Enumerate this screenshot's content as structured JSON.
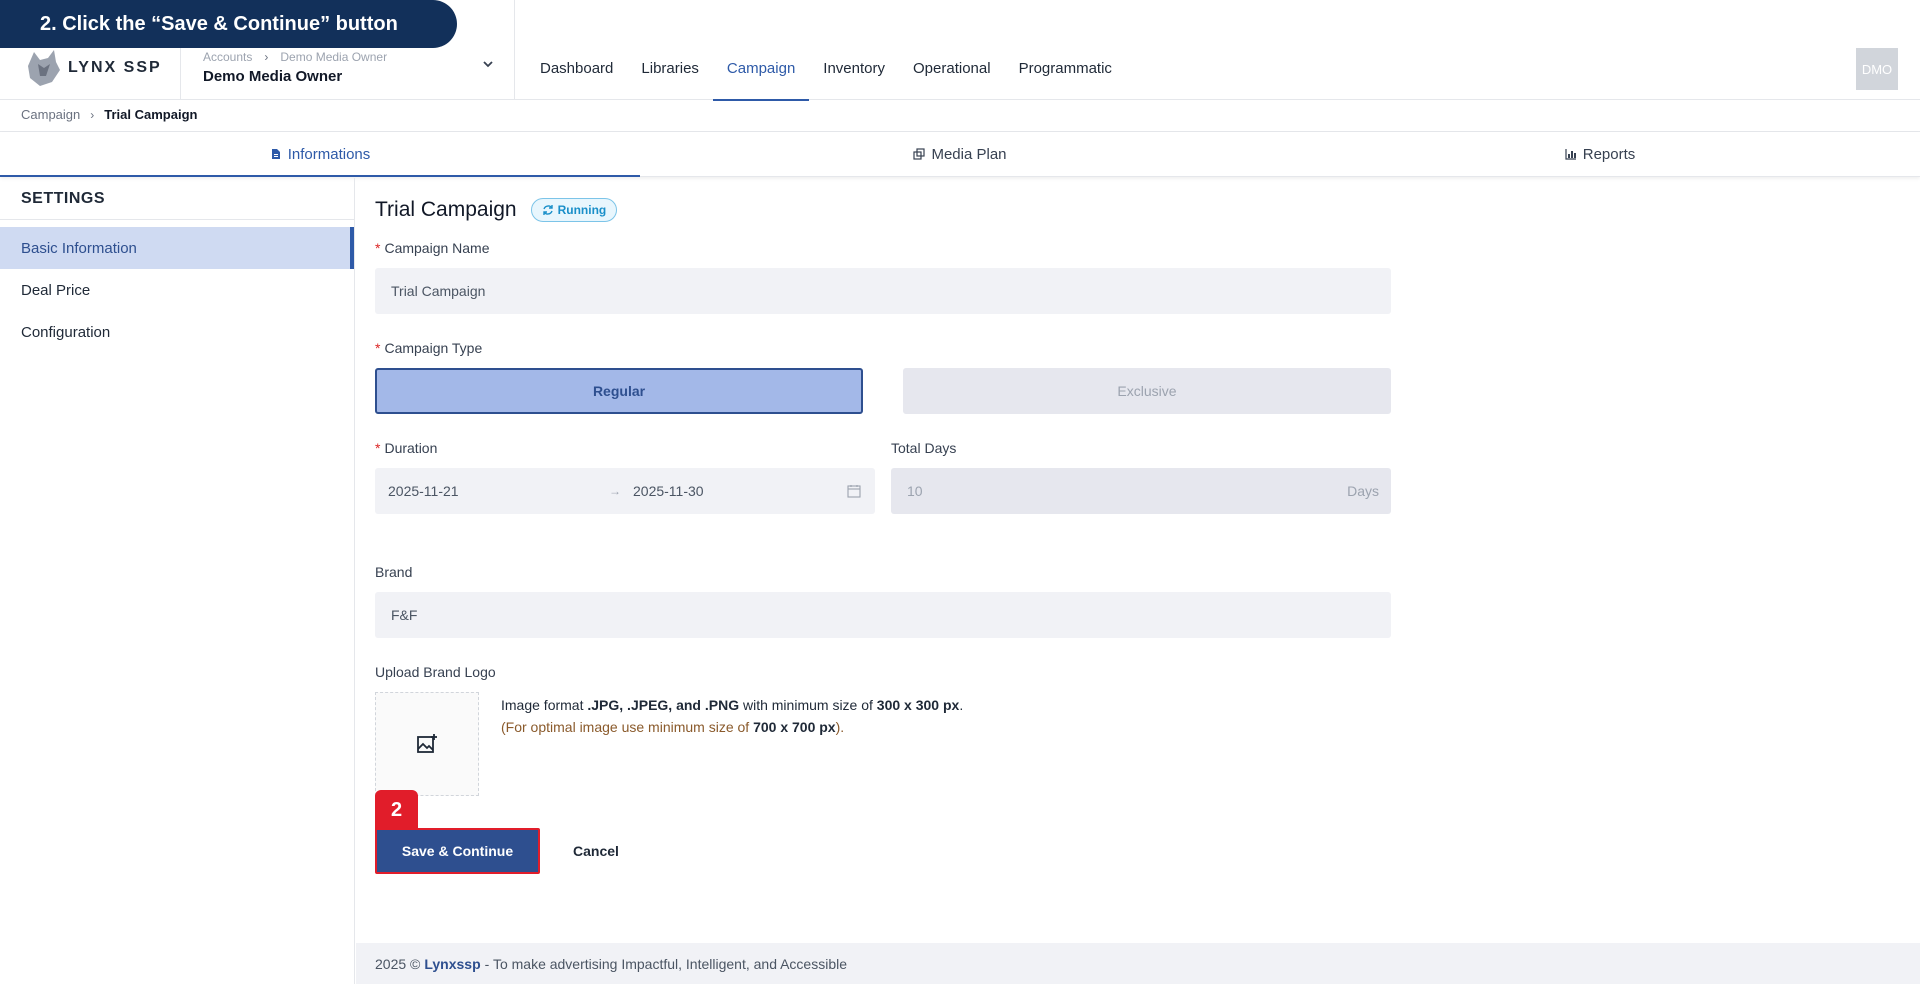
{
  "instruction": {
    "text": "2. Click the “Save & Continue” button"
  },
  "app": {
    "logo_text": "LYNX SSP"
  },
  "account": {
    "crumb_root": "Accounts",
    "crumb_current": "Demo Media Owner",
    "name": "Demo Media Owner"
  },
  "nav": {
    "items": [
      "Dashboard",
      "Libraries",
      "Campaign",
      "Inventory",
      "Operational",
      "Programmatic"
    ],
    "active": "Campaign"
  },
  "avatar": {
    "initials": "DMO"
  },
  "breadcrumb": {
    "root": "Campaign",
    "current": "Trial Campaign"
  },
  "tabs": {
    "informations": "Informations",
    "media_plan": "Media Plan",
    "reports": "Reports"
  },
  "sidebar": {
    "title": "SETTINGS",
    "items": [
      "Basic Information",
      "Deal Price",
      "Configuration"
    ]
  },
  "form": {
    "title": "Trial Campaign",
    "status": "Running",
    "campaign_name_label": "Campaign Name",
    "campaign_name_value": "Trial Campaign",
    "campaign_type_label": "Campaign Type",
    "type_regular": "Regular",
    "type_exclusive": "Exclusive",
    "duration_label": "Duration",
    "start_date": "2025-11-21",
    "date_separator": "→",
    "end_date": "2025-11-30",
    "total_days_label": "Total Days",
    "total_days_value": "10",
    "total_days_unit": "Days",
    "brand_label": "Brand",
    "brand_value": "F&F",
    "upload_label": "Upload Brand Logo",
    "upload_line1_pre": "Image format ",
    "upload_line1_formats": ".JPG, .JPEG, and .PNG",
    "upload_line1_mid": " with minimum size of ",
    "upload_line1_size": "300 x 300 px",
    "upload_line1_end": ".",
    "upload_line2_pre": "(For optimal image use minimum size of ",
    "upload_line2_size": "700 x 700 px",
    "upload_line2_end": ")."
  },
  "actions": {
    "step_number": "2",
    "save_label": "Save & Continue",
    "cancel_label": "Cancel"
  },
  "footer": {
    "prefix": "2025 ©",
    "brand": "Lynxssp",
    "suffix": "- To make advertising Impactful, Intelligent, and Accessible"
  },
  "colors": {
    "primary": "#2e4f8f",
    "accent_blue": "#2e5aa8",
    "highlight_red": "#e11d2a",
    "instruction_bg": "#12305a",
    "running_badge": "#1a8fc9"
  }
}
